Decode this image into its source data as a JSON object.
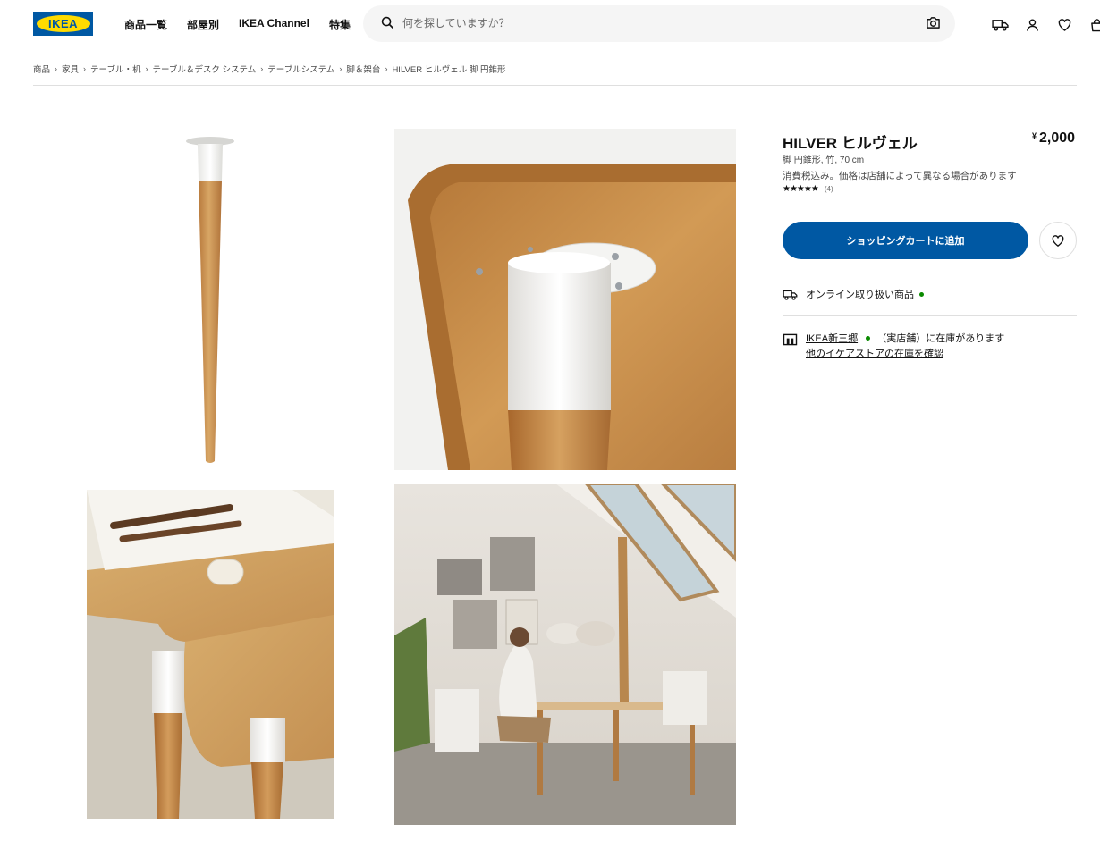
{
  "header": {
    "logo_text": "IKEA",
    "nav": [
      "商品一覧",
      "部屋別",
      "IKEA Channel",
      "特集"
    ],
    "search_placeholder": "何を探していますか？"
  },
  "breadcrumb": [
    "商品",
    "家具",
    "テーブル・机",
    "テーブル＆デスク システム",
    "テーブルシステム",
    "脚＆架台",
    "HILVER ヒルヴェル 脚 円錐形"
  ],
  "product": {
    "title": "HILVER ヒルヴェル",
    "currency": "¥",
    "price": "2,000",
    "description": "脚 円錐形, 竹, 70 cm",
    "tax_note": "消費税込み。価格は店舗によって異なる場合があります",
    "stars": "★★★★★",
    "rating_count": "(4)",
    "add_to_cart": "ショッピングカートに追加",
    "online_status": "オンライン取り扱い商品",
    "store_name": "IKEA新三郷",
    "store_status": "（実店舗）に在庫があります",
    "check_other": "他のイケアストアの在庫を確認"
  },
  "colors": {
    "brand_blue": "#0058a3",
    "brand_yellow": "#ffdb00",
    "in_stock": "#0a8a00"
  }
}
